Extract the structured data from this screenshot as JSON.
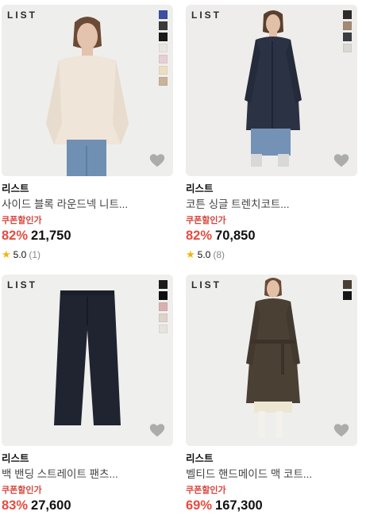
{
  "products": [
    {
      "brand_logo": "LIST",
      "brand": "리스트",
      "name": "사이드 블록 라운드넥 니트...",
      "coupon_label": "쿠폰할인가",
      "discount": "82%",
      "price": "21,750",
      "rating": "5.0",
      "review_count": "(1)",
      "swatches": [
        "#3d4ea6",
        "#3a3a3a",
        "#1a1a1a",
        "#e9e6df",
        "#e6cfd4",
        "#ecdfc0",
        "#c9b49a"
      ]
    },
    {
      "brand_logo": "LIST",
      "brand": "리스트",
      "name": "코튼 싱글 트렌치코트...",
      "coupon_label": "쿠폰할인가",
      "discount": "82%",
      "price": "70,850",
      "rating": "5.0",
      "review_count": "(8)",
      "swatches": [
        "#2b2b2b",
        "#a38a74",
        "#3a3d42",
        "#d9d8d2"
      ]
    },
    {
      "brand_logo": "LIST",
      "brand": "리스트",
      "name": "백 밴딩 스트레이트 팬츠...",
      "coupon_label": "쿠폰할인가",
      "discount": "83%",
      "price": "27,600",
      "swatches": [
        "#1c1c1c",
        "#0f0f0f",
        "#d9b0b0",
        "#ddd3c9",
        "#e6e2dc"
      ]
    },
    {
      "brand_logo": "LIST",
      "brand": "리스트",
      "name": "벨티드 핸드메이드 맥 코트...",
      "coupon_label": "쿠폰할인가",
      "discount": "69%",
      "price": "167,300",
      "swatches": [
        "#4a3f33",
        "#161616"
      ]
    }
  ],
  "colors": {
    "coupon": "#d9453c",
    "discount": "#e84a3f",
    "star": "#f5b400"
  },
  "icons": {
    "favorite": "heart-icon",
    "rating": "star-icon"
  }
}
